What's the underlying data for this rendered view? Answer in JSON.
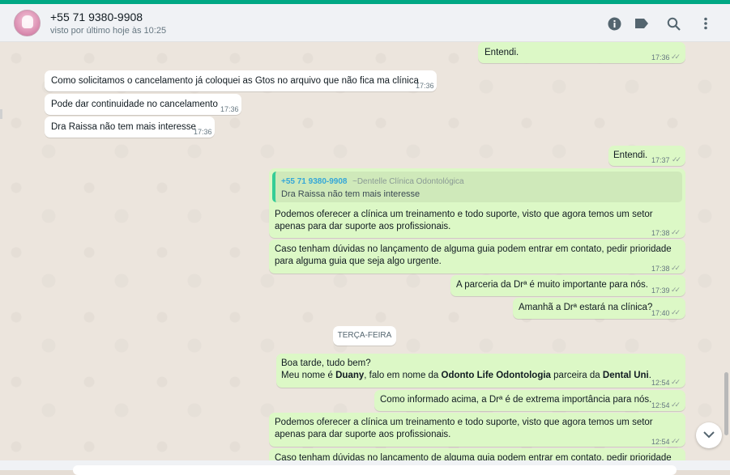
{
  "header": {
    "contact_name": "+55 71 9380-9908",
    "status": "visto por último hoje às 10:25",
    "avatar_icon": "clinic-logo-avatar",
    "icons": [
      "info-icon",
      "label-icon",
      "search-icon",
      "more-options-icon"
    ]
  },
  "messages": [
    {
      "text": "Entendi.",
      "time": "17:36",
      "direction": "out"
    },
    {
      "text": "Como solicitamos o cancelamento já coloquei as Gtos no arquivo que não fica ma clínica",
      "time": "17:36",
      "direction": "in"
    },
    {
      "text": "Pode dar continuidade no cancelamento",
      "time": "17:36",
      "direction": "in"
    },
    {
      "text": "Dra Raissa não tem mais interesse",
      "time": "17:36",
      "direction": "in"
    },
    {
      "text": "Entendi.",
      "time": "17:37",
      "direction": "out"
    },
    {
      "quote": {
        "author": "+55 71 9380-9908",
        "pushname": "~Dentelle Clínica Odontológica",
        "text": "Dra Raissa não tem mais interesse"
      },
      "text": "Podemos oferecer a clínica um treinamento e todo suporte, visto que agora temos um setor apenas para dar suporte aos profissionais.",
      "time": "17:38",
      "direction": "out"
    },
    {
      "text": "Caso tenham dúvidas no lançamento de alguma guia podem entrar em contato, pedir prioridade para alguma guia que seja algo urgente.",
      "time": "17:38",
      "direction": "out"
    },
    {
      "text": "A parceria da Drª é muito importante para nós.",
      "time": "17:39",
      "direction": "out"
    },
    {
      "text": "Amanhã a Drª estará na clínica?",
      "time": "17:40",
      "direction": "out"
    },
    {
      "line1": "Boa tarde, tudo bem?",
      "line2_parts": [
        "Meu nome é ",
        "Duany",
        ", falo em nome da ",
        "Odonto Life Odontologia",
        " parceira da ",
        "Dental Uni",
        "."
      ],
      "time": "12:54",
      "direction": "out"
    },
    {
      "text": "Como informado acima, a Drª é de extrema importância para nós.",
      "time": "12:54",
      "direction": "out"
    },
    {
      "text": "Podemos oferecer a clínica um treinamento e todo suporte, visto que agora temos um setor apenas para dar suporte aos profissionais.",
      "time": "12:54",
      "direction": "out"
    },
    {
      "text": "Caso tenham dúvidas no lançamento de alguma guia podem entrar em contato, pedir prioridade",
      "direction": "out"
    }
  ],
  "day_separator": "TERÇA-FEIRA",
  "read_ticks": "✓✓",
  "scroll_down_icon": "chevron-down-icon",
  "colors": {
    "accent": "#00a884",
    "outgoing_bubble": "#dcf8c6",
    "incoming_bubble": "#ffffff",
    "quote_author": "#35a7d8"
  }
}
